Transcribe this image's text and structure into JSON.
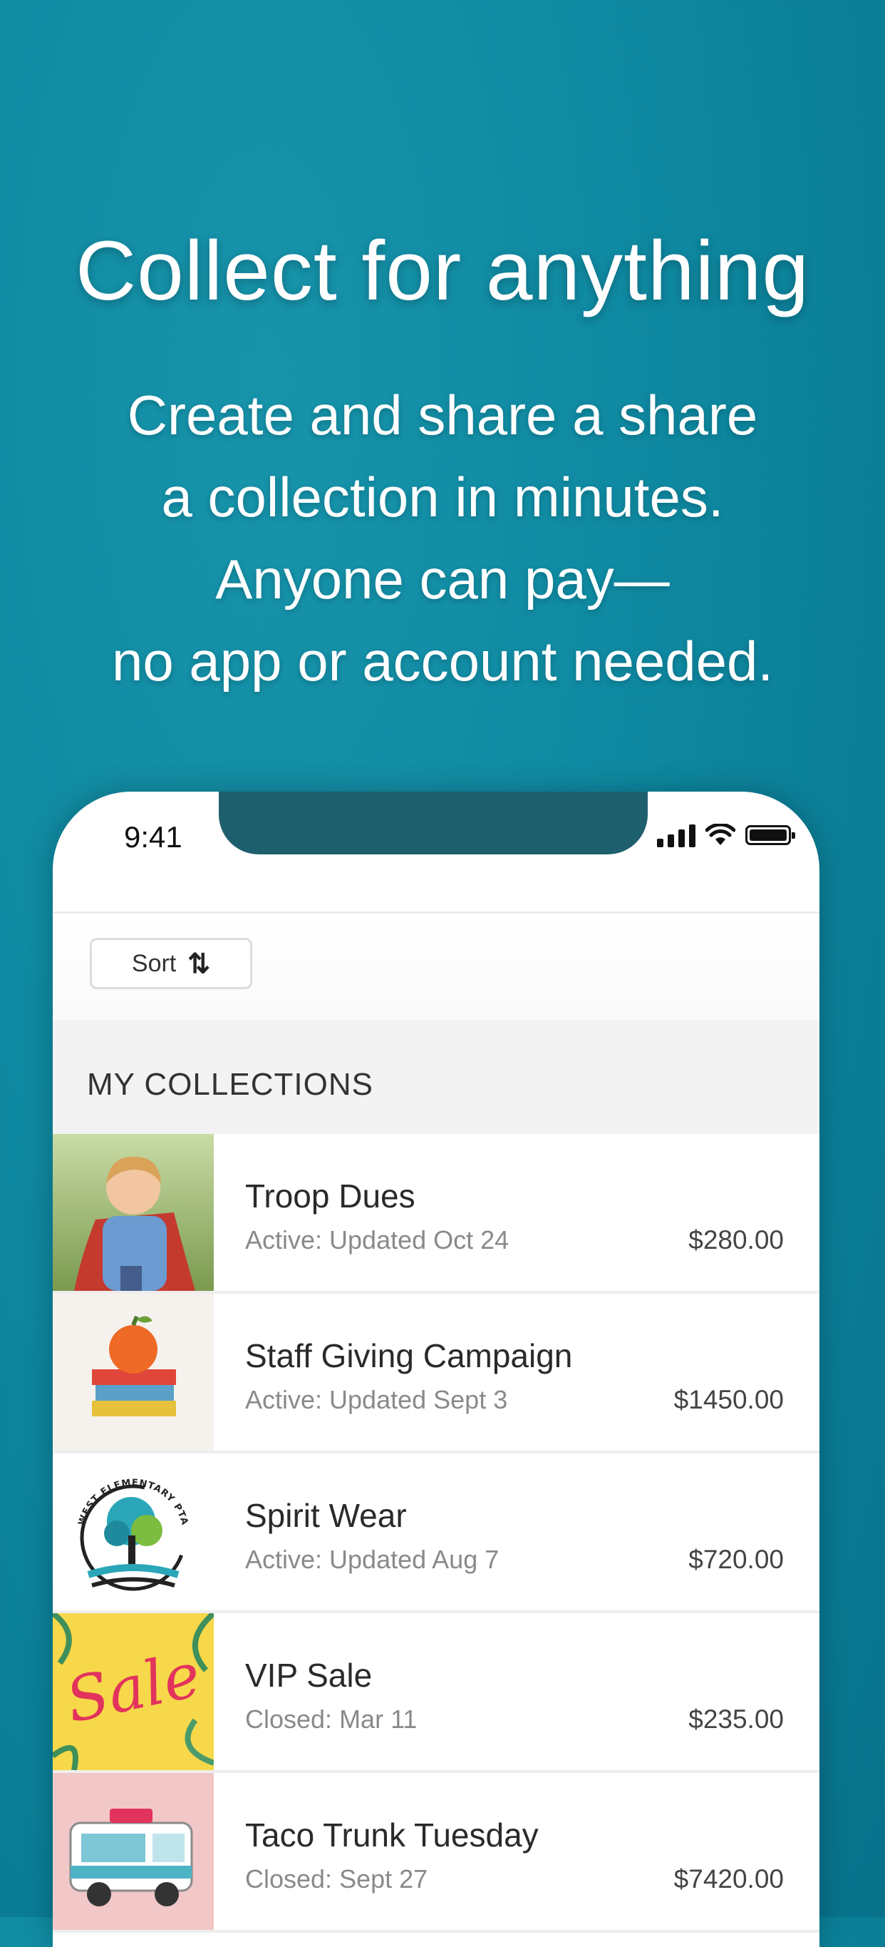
{
  "hero": {
    "headline": "Collect for anything",
    "sub_lines": [
      "Create and share a share",
      "a collection in minutes.",
      "Anyone can pay—",
      "no app or account needed."
    ]
  },
  "status_bar": {
    "time": "9:41",
    "icons": [
      "signal-icon",
      "wifi-icon",
      "battery-icon"
    ]
  },
  "toolbar": {
    "sort_label": "Sort",
    "sort_icon": "⇅"
  },
  "section": {
    "title": "MY COLLECTIONS"
  },
  "collections": [
    {
      "title": "Troop Dues",
      "status": "Active: Updated Oct 24",
      "amount": "$280.00",
      "thumb": "child-superhero-photo"
    },
    {
      "title": "Staff Giving Campaign",
      "status": "Active: Updated Sept 3",
      "amount": "$1450.00",
      "thumb": "apple-books-icon"
    },
    {
      "title": "Spirit Wear",
      "status": "Active: Updated Aug 7",
      "amount": "$720.00",
      "thumb": "tree-logo",
      "logo_text": "WEST ELEMENTARY PTA"
    },
    {
      "title": "VIP Sale",
      "status": "Closed: Mar 11",
      "amount": "$235.00",
      "thumb": "sale-graphic",
      "thumb_text": "Sale"
    },
    {
      "title": "Taco Trunk Tuesday",
      "status": "Closed: Sept 27",
      "amount": "$7420.00",
      "thumb": "food-truck-illustration"
    }
  ],
  "colors": {
    "background": "#0f8aa2",
    "notch": "#1e5f6e",
    "text_primary": "#2a2a2a",
    "text_secondary": "#8a8a8a"
  }
}
